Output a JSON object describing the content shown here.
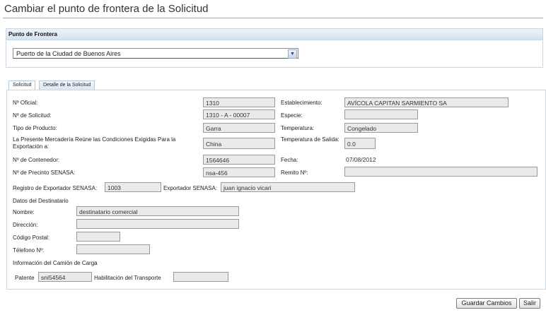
{
  "page_title": "Cambiar el punto de frontera de la Solicitud",
  "frontera": {
    "header": "Punto de Frontera",
    "selected": "Puerto de la Ciudad de Buenos Aires"
  },
  "tabs": [
    "Solicitud",
    "Detalle de la Solicitud"
  ],
  "form": {
    "oficial": {
      "label": "Nº Oficial:",
      "value": "1310"
    },
    "solicitud": {
      "label": "Nº de Solicitud:",
      "value": "1310 - A - 00007"
    },
    "tipo_producto": {
      "label": "Tipo de Producto:",
      "value": "Garra"
    },
    "mercaderia": {
      "label": "La Presente Mercadería Reúne las Condiciones Exigidas Para la Exportación a:",
      "value": "China"
    },
    "contenedor": {
      "label": "Nº de Contenedor:",
      "value": "1564646"
    },
    "precinto": {
      "label": "Nº de Precinto SENASA:",
      "value": "nsa-456"
    },
    "establecimiento": {
      "label": "Establecimiento:",
      "value": "AVÍCOLA CAPITAN SARMIENTO SA"
    },
    "especie": {
      "label": "Especie:",
      "value": ""
    },
    "temperatura": {
      "label": "Temperatura:",
      "value": "Congelado"
    },
    "temp_salida": {
      "label": "Temperatura de Salida:",
      "value": "0.0"
    },
    "fecha": {
      "label": "Fecha:",
      "value": "07/08/2012"
    },
    "remito": {
      "label": "Remito Nº:",
      "value": ""
    },
    "registro_exportador": {
      "label": "Registro de Exportador SENASA:",
      "value": "1003"
    },
    "exportador": {
      "label": "Exportador SENASA:",
      "value": "juan ignacio vicari"
    },
    "destinatario_section": "Datos del Destinatario",
    "nombre": {
      "label": "Nombre:",
      "value": "destinatario comercial"
    },
    "direccion": {
      "label": "Dirección:",
      "value": ""
    },
    "codigo_postal": {
      "label": "Código Postal:",
      "value": ""
    },
    "telefono": {
      "label": "Télefono Nº:",
      "value": ""
    },
    "camion_section": "Información del Camión de Carga",
    "patente": {
      "label": "Patente",
      "value": "sni54564"
    },
    "habilitacion": {
      "label": "Habilitación del Transporte",
      "value": ""
    }
  },
  "buttons": {
    "save": "Guardar Cambios",
    "exit": "Salir"
  },
  "colors": {
    "title_rule": "#7fb3d5",
    "field_bg": "#eaeaea",
    "panel_border": "#c9d6e4"
  }
}
